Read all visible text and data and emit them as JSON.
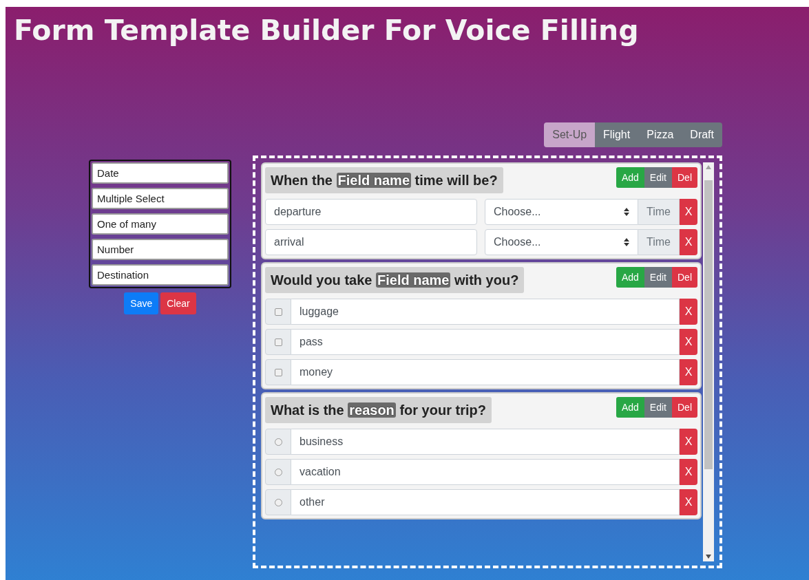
{
  "title": "Form Template Builder For Voice Filling",
  "field_types": [
    {
      "label": "Date"
    },
    {
      "label": "Multiple Select"
    },
    {
      "label": "One of many"
    },
    {
      "label": "Number"
    },
    {
      "label": "Destination"
    }
  ],
  "panel_buttons": [
    {
      "label": "Save",
      "kind": "primary"
    },
    {
      "label": "Clear",
      "kind": "danger"
    }
  ],
  "tabs": [
    {
      "label": "Set-Up",
      "selected": true
    },
    {
      "label": "Flight",
      "selected": false
    },
    {
      "label": "Pizza",
      "selected": false
    },
    {
      "label": "Draft",
      "selected": false
    }
  ],
  "questions": [
    {
      "kind": "time",
      "title": "When the **Field name** time will be?",
      "actions": [
        "Add",
        "Edit",
        "Del"
      ],
      "options": [
        {
          "value": "departure",
          "select_placeholder": "Choose...",
          "addon": "Time",
          "remove": "X"
        },
        {
          "value": "arrival",
          "select_placeholder": "Choose...",
          "addon": "Time",
          "remove": "X"
        }
      ]
    },
    {
      "kind": "checkbox",
      "title": "Would you take **Field name** with you?",
      "actions": [
        "Add",
        "Edit",
        "Del"
      ],
      "options": [
        {
          "value": "luggage",
          "checked": false,
          "remove": "X"
        },
        {
          "value": "pass",
          "checked": false,
          "remove": "X"
        },
        {
          "value": "money",
          "checked": false,
          "remove": "X"
        }
      ]
    },
    {
      "kind": "radio",
      "title": "What is the **reason** for your trip?",
      "actions": [
        "Add",
        "Edit",
        "Del"
      ],
      "options": [
        {
          "value": "business",
          "selected": false,
          "remove": "X"
        },
        {
          "value": "vacation",
          "selected": false,
          "remove": "X"
        },
        {
          "value": "other",
          "selected": false,
          "remove": "X"
        }
      ]
    }
  ]
}
